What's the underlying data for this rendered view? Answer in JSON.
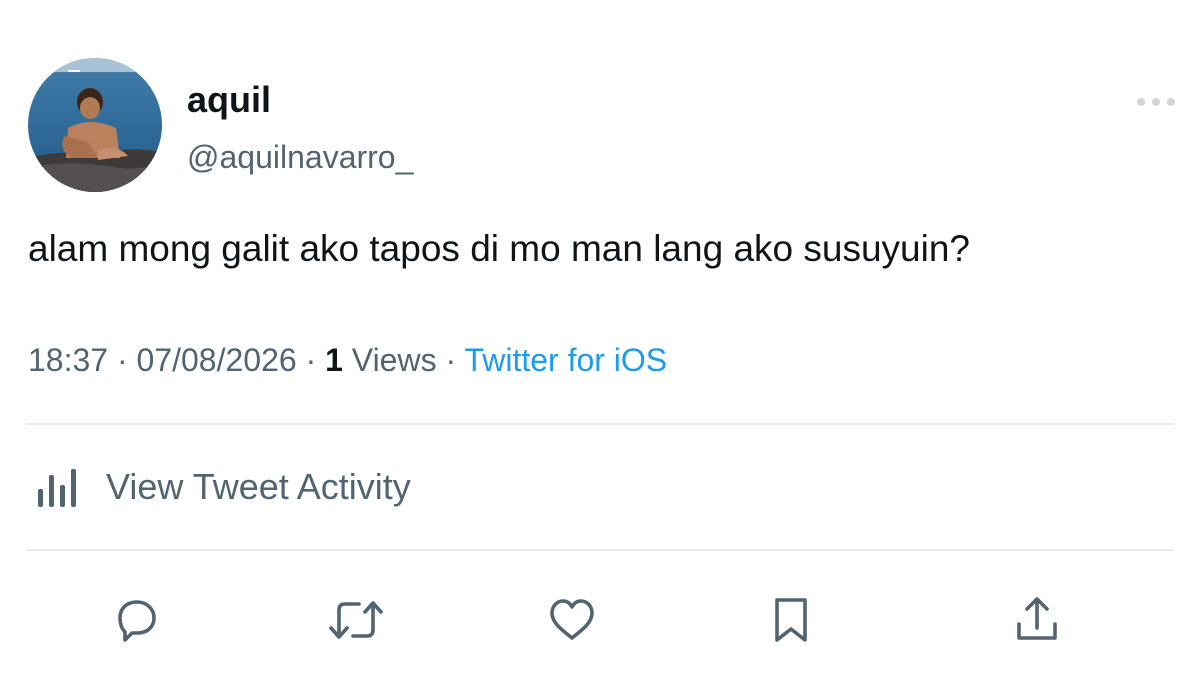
{
  "user": {
    "display_name": "aquil",
    "handle": "@aquilnavarro_"
  },
  "tweet": {
    "text": "alam mong galit ako tapos di mo man lang ako susuyuin?"
  },
  "meta": {
    "time": "18:37",
    "separator": " · ",
    "date": "07/08/2026",
    "views_count": "1",
    "views_label": " Views",
    "source": "Twitter for iOS"
  },
  "activity": {
    "label": "View Tweet Activity",
    "icon": "bar-chart-icon"
  },
  "actions": [
    {
      "icon": "reply-icon"
    },
    {
      "icon": "retweet-icon"
    },
    {
      "icon": "like-icon"
    },
    {
      "icon": "bookmark-icon"
    },
    {
      "icon": "share-icon"
    }
  ],
  "colors": {
    "text_primary": "#0f1419",
    "text_secondary": "#536471",
    "link": "#1d9bf0",
    "divider": "#e7ecf0"
  }
}
